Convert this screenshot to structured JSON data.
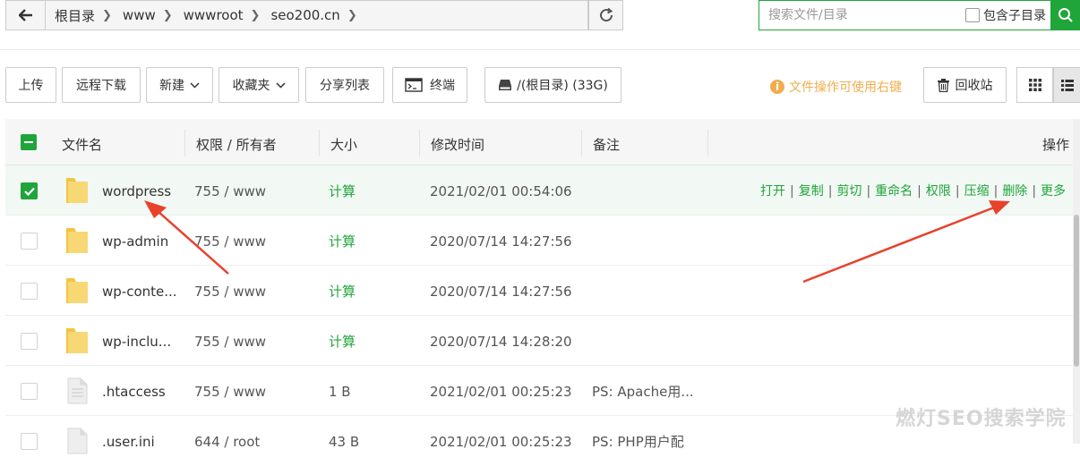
{
  "breadcrumb": {
    "items": [
      "根目录",
      "www",
      "wwwroot",
      "seo200.cn"
    ]
  },
  "search": {
    "placeholder": "搜索文件/目录",
    "include_subdirs_label": "包含子目录"
  },
  "toolbar": {
    "upload": "上传",
    "remote_download": "远程下载",
    "new": "新建",
    "favorites": "收藏夹",
    "share_list": "分享列表",
    "terminal": "终端",
    "disk": "/(根目录) (33G)",
    "tip": "文件操作可使用右键",
    "recycle_bin": "回收站"
  },
  "table": {
    "headers": {
      "name": "文件名",
      "perm": "权限 / 所有者",
      "size": "大小",
      "mtime": "修改时间",
      "note": "备注",
      "ops": "操作"
    },
    "rows": [
      {
        "name": "wordpress",
        "perm": "755 / www",
        "size": "计算",
        "mtime": "2021/02/01 00:54:06",
        "note": "",
        "type": "folder",
        "selected": true
      },
      {
        "name": "wp-admin",
        "perm": "755 / www",
        "size": "计算",
        "mtime": "2020/07/14 14:27:56",
        "note": "",
        "type": "folder",
        "selected": false
      },
      {
        "name": "wp-conte...",
        "perm": "755 / www",
        "size": "计算",
        "mtime": "2020/07/14 14:27:56",
        "note": "",
        "type": "folder",
        "selected": false
      },
      {
        "name": "wp-inclu...",
        "perm": "755 / www",
        "size": "计算",
        "mtime": "2020/07/14 14:28:20",
        "note": "",
        "type": "folder",
        "selected": false
      },
      {
        "name": ".htaccess",
        "perm": "755 / www",
        "size": "1 B",
        "mtime": "2021/02/01 00:25:23",
        "note": "PS: Apache用...",
        "type": "file",
        "selected": false
      },
      {
        "name": ".user.ini",
        "perm": "644 / root",
        "size": "43 B",
        "mtime": "2021/02/01 00:25:23",
        "note": "PS: PHP用户配",
        "type": "file",
        "selected": false
      }
    ],
    "row_actions": {
      "open": "打开",
      "copy": "复制",
      "cut": "剪切",
      "rename": "重命名",
      "perm": "权限",
      "compress": "压缩",
      "delete": "删除",
      "more": "更多"
    }
  },
  "watermark": "燃灯SEO搜索学院",
  "colors": {
    "accent": "#20a53a",
    "warning": "#f0ad4e",
    "folder": "#f7d26a",
    "arrow": "#e8412c"
  }
}
